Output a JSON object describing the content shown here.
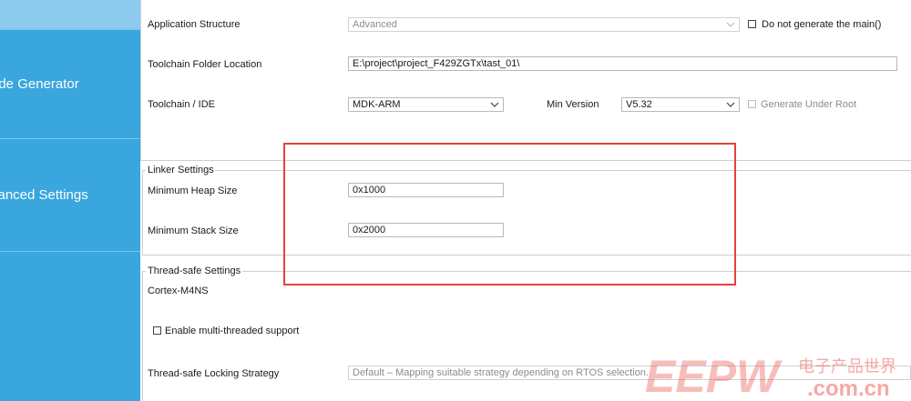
{
  "sidebar": {
    "items": [
      {
        "label": "ode Generator"
      },
      {
        "label": "vanced Settings"
      }
    ]
  },
  "project": {
    "app_structure_label": "Application Structure",
    "app_structure_value": "Advanced",
    "no_main_label": "Do not generate the main()",
    "toolchain_folder_label": "Toolchain Folder Location",
    "toolchain_folder_value": "E:\\project\\project_F429ZGTx\\tast_01\\",
    "toolchain_ide_label": "Toolchain / IDE",
    "toolchain_ide_value": "MDK-ARM",
    "min_version_label": "Min Version",
    "min_version_value": "V5.32",
    "generate_root_label": "Generate Under Root"
  },
  "linker": {
    "title": "Linker Settings",
    "heap_label": "Minimum Heap Size",
    "heap_value": "0x1000",
    "stack_label": "Minimum Stack Size",
    "stack_value": "0x2000"
  },
  "thread": {
    "title": "Thread-safe Settings",
    "core_label": "Cortex-M4NS",
    "multi_label": "Enable multi-threaded support",
    "locking_label": "Thread-safe Locking Strategy",
    "locking_value": "Default – Mapping suitable strategy depending on RTOS selection."
  },
  "watermark": {
    "brand": "EEPW",
    "cn": "电子产品世界",
    "domain": ".com.cn"
  },
  "colors": {
    "sidebar": "#39a6dd",
    "sidebar_top": "#8ccbed",
    "highlight": "#e8413a"
  }
}
